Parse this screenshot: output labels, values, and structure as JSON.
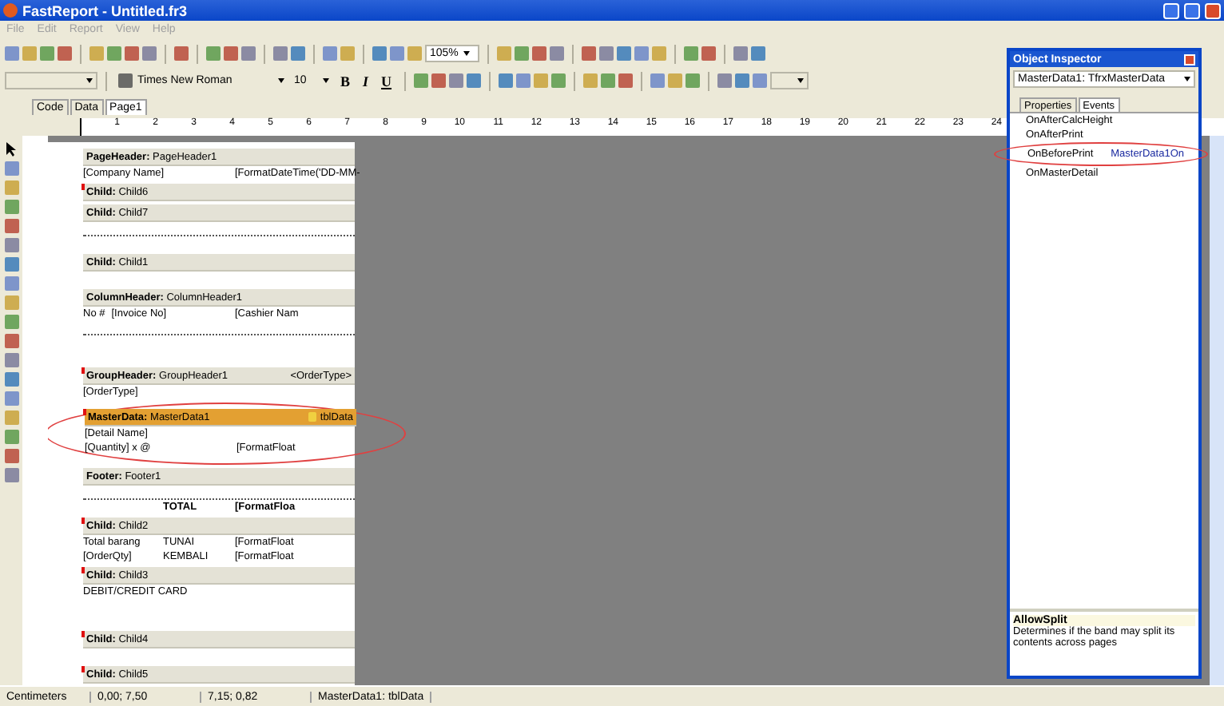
{
  "window": {
    "title": "FastReport - Untitled.fr3"
  },
  "menu": [
    "File",
    "Edit",
    "Report",
    "View",
    "Help"
  ],
  "toolbar": {
    "zoom": "105%",
    "font_name": "Times New Roman",
    "font_size": "10",
    "format_buttons": [
      "B",
      "I",
      "U"
    ]
  },
  "tabs": [
    {
      "label": "Code",
      "selected": false
    },
    {
      "label": "Data",
      "selected": false
    },
    {
      "label": "Page1",
      "selected": true
    }
  ],
  "ruler": [
    "1",
    "2",
    "3",
    "4",
    "5",
    "6",
    "7",
    "8",
    "9",
    "10",
    "11",
    "12",
    "13",
    "14",
    "15",
    "16",
    "17",
    "18",
    "19",
    "20",
    "21",
    "22",
    "23",
    "24"
  ],
  "bands": [
    {
      "title": "**PageHeader:** PageHeader1",
      "marked": false,
      "selected": false,
      "highlighted": false,
      "rows": [
        {
          "kind": "fields",
          "left": [
            {
              "text": "[Company Name]",
              "kind": "plain"
            }
          ],
          "right": [
            {
              "text": "[FormatDateTime('DD-MM-",
              "kind": "plain"
            }
          ]
        }
      ]
    },
    {
      "title": "**Child:** Child6",
      "marked": true,
      "selected": false,
      "highlighted": false
    },
    {
      "title": "**Child:** Child7",
      "marked": false,
      "selected": false,
      "highlighted": false,
      "rows": [
        {
          "kind": "dotted"
        },
        {
          "kind": "blank"
        }
      ]
    },
    {
      "title": "**Child:** Child1",
      "marked": false,
      "selected": false,
      "highlighted": false,
      "rows": [
        {
          "kind": "blank"
        }
      ]
    },
    {
      "title": "**ColumnHeader:** ColumnHeader1",
      "marked": false,
      "selected": false,
      "highlighted": false,
      "rows": [
        {
          "kind": "fields",
          "left": [
            {
              "text": "No #",
              "kind": "plain"
            },
            {
              "text": "[Invoice No]",
              "kind": "plain"
            }
          ],
          "right": [
            {
              "text": "[Cashier Nam",
              "kind": "plain"
            }
          ]
        },
        {
          "kind": "dotted"
        },
        {
          "kind": "blank"
        },
        {
          "kind": "blank"
        }
      ]
    },
    {
      "title": "**GroupHeader:** GroupHeader1",
      "tag": "<OrderType>",
      "marked": true,
      "selected": false,
      "highlighted": false,
      "rows": [
        {
          "kind": "fields",
          "left": [
            {
              "text": "[OrderType]",
              "kind": "plain"
            }
          ]
        }
      ]
    },
    {
      "title": "**MasterData:** MasterData1",
      "tag": "tblData",
      "marked": true,
      "selected": true,
      "highlighted": true,
      "rows": [
        {
          "kind": "fields",
          "left": [
            {
              "text": "[Detail Name]",
              "kind": "plain"
            }
          ]
        },
        {
          "kind": "fields",
          "left": [
            {
              "text": "[Quantity] x @",
              "kind": "plain"
            }
          ],
          "right": [
            {
              "text": "[FormatFloat",
              "kind": "plain"
            }
          ]
        }
      ]
    },
    {
      "title": "**Footer:** Footer1",
      "marked": false,
      "selected": false,
      "highlighted": false,
      "rows": [
        {
          "kind": "dotted"
        },
        {
          "kind": "fields",
          "middle": [
            {
              "text": "TOTAL",
              "kind": "bold"
            }
          ],
          "right": [
            {
              "text": "[FormatFloa",
              "kind": "bold"
            }
          ]
        }
      ]
    },
    {
      "title": "**Child:** Child2",
      "marked": true,
      "selected": false,
      "highlighted": false,
      "rows": [
        {
          "kind": "fields",
          "left": [
            {
              "text": "Total barang",
              "kind": "plain"
            }
          ],
          "middle": [
            {
              "text": "TUNAI",
              "kind": "plain"
            }
          ],
          "right": [
            {
              "text": "[FormatFloat",
              "kind": "plain"
            }
          ]
        },
        {
          "kind": "fields",
          "left": [
            {
              "text": "[OrderQty]",
              "kind": "plain"
            }
          ],
          "middle": [
            {
              "text": "KEMBALI",
              "kind": "plain"
            }
          ],
          "right": [
            {
              "text": "[FormatFloat",
              "kind": "plain"
            }
          ]
        }
      ]
    },
    {
      "title": "**Child:** Child3",
      "marked": true,
      "selected": false,
      "highlighted": false,
      "rows": [
        {
          "kind": "fields",
          "left": [
            {
              "text": "DEBIT/CREDIT CARD",
              "kind": "plain"
            }
          ]
        },
        {
          "kind": "blank"
        },
        {
          "kind": "blank"
        }
      ]
    },
    {
      "title": "**Child:** Child4",
      "marked": true,
      "selected": false,
      "highlighted": false,
      "rows": [
        {
          "kind": "blank"
        }
      ]
    },
    {
      "title": "**Child:** Child5",
      "marked": true,
      "selected": false,
      "highlighted": false
    }
  ],
  "inspector": {
    "title": "Object Inspector",
    "object": "MasterData1: TfrxMasterData",
    "tabs": [
      {
        "label": "Properties",
        "selected": false
      },
      {
        "label": "Events",
        "selected": true
      }
    ],
    "events": [
      {
        "name": "OnAfterCalcHeight",
        "highlighted": false
      },
      {
        "name": "OnAfterPrint",
        "highlighted": false
      },
      {
        "name": "OnBeforePrint",
        "value": "MasterData1On",
        "highlighted": true
      },
      {
        "name": "OnMasterDetail",
        "highlighted": false
      }
    ],
    "help_title": "AllowSplit",
    "help_text": "Determines if the band may split its contents across pages"
  },
  "status_bar": [
    "Centimeters",
    "0,00; 7,50",
    "7,15; 0,82",
    "MasterData1: tblData"
  ]
}
